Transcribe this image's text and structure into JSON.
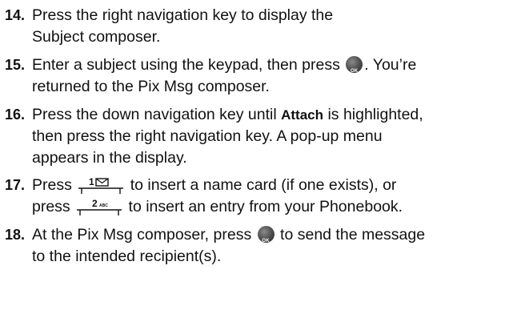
{
  "steps": [
    {
      "number": "14.",
      "lines": [
        "Press the right navigation key to display the",
        "Subject composer."
      ]
    },
    {
      "number": "15.",
      "line1_before": "Enter a subject using the keypad, then press",
      "line1_after": ". You’re",
      "line2": "returned to the Pix Msg composer.",
      "button_label": "OK"
    },
    {
      "number": "16.",
      "line1_before": "Press the down navigation key until",
      "line1_bold": "Attach",
      "line1_after": "is highlighted,",
      "line2": "then press the right navigation key. A pop-up menu",
      "line3": "appears in the display."
    },
    {
      "number": "17.",
      "line1_before": "Press",
      "line1_after": "to insert a name card (if one exists), or",
      "line2_before": "press",
      "line2_after": "to insert an entry from your Phonebook.",
      "key1_label": "1",
      "key2_label": "2",
      "key2_letters": "ABC"
    },
    {
      "number": "18.",
      "line1_before": "At the Pix Msg composer, press",
      "line1_after": "to send the message",
      "line2": "to the intended recipient(s).",
      "button_label": "OK"
    }
  ],
  "icons": {
    "ok_button": "ok-button-icon",
    "key_1": "key-1-mail-icon",
    "key_2": "key-2-abc-icon"
  }
}
